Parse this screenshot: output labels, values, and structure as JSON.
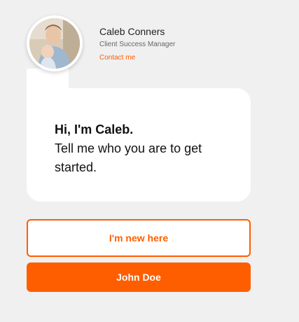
{
  "agent": {
    "name": "Caleb Conners",
    "role": "Client Success Manager",
    "contact_label": "Contact me"
  },
  "message": {
    "greeting": "Hi, I'm Caleb.",
    "body": "Tell me who you are to get started."
  },
  "buttons": {
    "new_here_label": "I'm new here",
    "returning_label": "John Doe"
  },
  "colors": {
    "accent": "#ff5e00",
    "background": "#f0f0f0",
    "card": "#ffffff"
  }
}
